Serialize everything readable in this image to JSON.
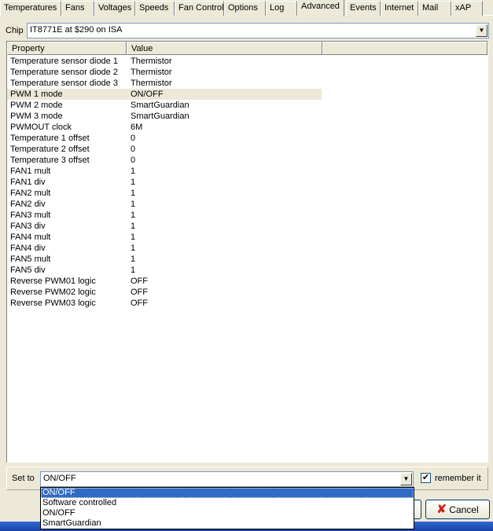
{
  "tabs": [
    "Temperatures",
    "Fans",
    "Voltages",
    "Speeds",
    "Fan Control",
    "Options",
    "Log",
    "Advanced",
    "Events",
    "Internet",
    "Mail",
    "xAP"
  ],
  "selected_tab": "Advanced",
  "chip": {
    "label": "Chip",
    "value": "IT8771E at $290 on ISA"
  },
  "table": {
    "headers": [
      "Property",
      "Value"
    ],
    "rows": [
      [
        "Temperature sensor diode 1",
        "Thermistor"
      ],
      [
        "Temperature sensor diode 2",
        "Thermistor"
      ],
      [
        "Temperature sensor diode 3",
        "Thermistor"
      ],
      [
        "PWM 1 mode",
        "ON/OFF"
      ],
      [
        "PWM 2 mode",
        "SmartGuardian"
      ],
      [
        "PWM 3 mode",
        "SmartGuardian"
      ],
      [
        "PWMOUT clock",
        "6M"
      ],
      [
        "Temperature 1 offset",
        "0"
      ],
      [
        "Temperature 2 offset",
        "0"
      ],
      [
        "Temperature 3 offset",
        "0"
      ],
      [
        "FAN1 mult",
        "1"
      ],
      [
        "FAN1 div",
        "1"
      ],
      [
        "FAN2 mult",
        "1"
      ],
      [
        "FAN2 div",
        "1"
      ],
      [
        "FAN3 mult",
        "1"
      ],
      [
        "FAN3 div",
        "1"
      ],
      [
        "FAN4 mult",
        "1"
      ],
      [
        "FAN4 div",
        "1"
      ],
      [
        "FAN5 mult",
        "1"
      ],
      [
        "FAN5 div",
        "1"
      ],
      [
        "Reverse PWM01 logic",
        "OFF"
      ],
      [
        "Reverse PWM02 logic",
        "OFF"
      ],
      [
        "Reverse PWM03 logic",
        "OFF"
      ]
    ],
    "selected_row": 3
  },
  "set_to": {
    "label": "Set to",
    "value": "ON/OFF",
    "options": [
      "ON/OFF",
      "Software controlled",
      "ON/OFF",
      "SmartGuardian"
    ],
    "remember_label": "remember it",
    "remember_checked": true
  },
  "cancel_label": "Cancel"
}
